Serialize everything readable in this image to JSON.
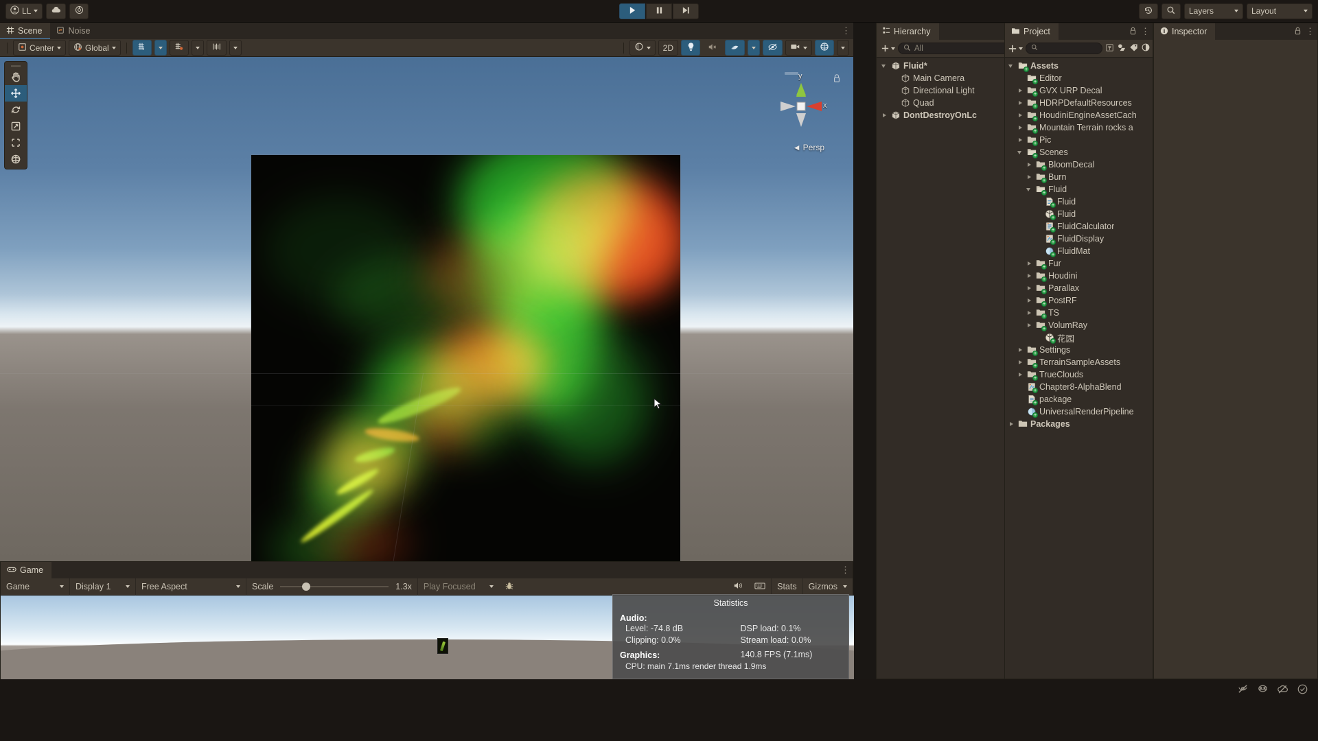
{
  "toolbar": {
    "account_label": "LL",
    "account_icon": "person-icon",
    "cloud_icon": "cloud-icon",
    "services_icon": "services-icon",
    "play_icon": "play-icon",
    "pause_icon": "pause-icon",
    "step_icon": "step-icon",
    "undo_history_icon": "undo-history-icon",
    "search_icon": "search-icon",
    "layers_label": "Layers",
    "layout_label": "Layout"
  },
  "scene": {
    "tabs": [
      {
        "label": "Scene",
        "icon": "scene-grid-icon",
        "selected": true
      },
      {
        "label": "Noise",
        "icon": "noise-icon",
        "selected": false
      }
    ],
    "toolbar": {
      "pivot_label": "Center",
      "pivot_icon": "pivot-center-icon",
      "handle_label": "Global",
      "handle_icon": "globe-icon",
      "grid_icon": "grid-snap-icon",
      "grid_caret": "chevron-down-icon",
      "snap_icon": "snap-increment-icon",
      "snap_caret": "chevron-down-icon",
      "component_icon": "component-tools-icon",
      "component_caret": "chevron-down-icon",
      "shading_icon": "shading-mode-icon",
      "shading_caret": "chevron-down-icon",
      "twod_label": "2D",
      "light_icon": "lighting-icon",
      "audio_icon": "audio-mute-icon",
      "fx_icon": "effects-icon",
      "fx_caret": "chevron-down-icon",
      "hidden_icon": "hidden-objects-icon",
      "camera_icon": "scene-camera-icon",
      "camera_caret": "chevron-down-icon",
      "gizmos_icon": "gizmos-icon",
      "gizmos_caret": "chevron-down-icon"
    },
    "tools": [
      {
        "name": "hand-tool",
        "icon": "hand-icon",
        "active": false
      },
      {
        "name": "move-tool",
        "icon": "move-icon",
        "active": true
      },
      {
        "name": "rotate-tool",
        "icon": "rotate-icon",
        "active": false
      },
      {
        "name": "scale-tool",
        "icon": "scale-icon",
        "active": false
      },
      {
        "name": "rect-tool",
        "icon": "rect-transform-icon",
        "active": false
      },
      {
        "name": "transform-tool",
        "icon": "transform-icon",
        "active": false
      }
    ],
    "gizmo": {
      "axis_y": "y",
      "axis_x": "x",
      "projection_label": "Persp",
      "lock_icon": "lock-icon"
    },
    "cursor_icon": "mouse-pointer-icon"
  },
  "game": {
    "tab_label": "Game",
    "tab_icon": "game-controller-icon",
    "view_select": "Game",
    "display_select": "Display 1",
    "aspect_select": "Free Aspect",
    "scale_label": "Scale",
    "scale_value": "1.3x",
    "play_mode_select": "Play Focused",
    "debug_icon": "bug-icon",
    "mute_icon": "mute-audio-icon",
    "aspect_icon": "aspect-frame-icon",
    "stats_label": "Stats",
    "gizmos_label": "Gizmos",
    "gizmos_caret": "chevron-down-icon"
  },
  "statistics": {
    "title": "Statistics",
    "audio_header": "Audio:",
    "level": "Level: -74.8 dB",
    "clipping": "Clipping: 0.0%",
    "dsp_load": "DSP load: 0.1%",
    "stream_load": "Stream load: 0.0%",
    "graphics_header": "Graphics:",
    "fps": "140.8 FPS (7.1ms)",
    "cpu": "CPU: main 7.1ms  render thread 1.9ms"
  },
  "hierarchy": {
    "tab_label": "Hierarchy",
    "lock_icon": "lock-icon",
    "menu_icon": "kebab-menu-icon",
    "add_icon": "plus-icon",
    "search_placeholder": "All",
    "search_icon": "search-icon",
    "filter_icon": "filter-icon",
    "items": [
      {
        "label": "Fluid*",
        "depth": 0,
        "arrow": "down",
        "icon": "scene-icon",
        "menu": true
      },
      {
        "label": "Main Camera",
        "depth": 1,
        "arrow": "none",
        "icon": "gameobject-icon",
        "menu": false
      },
      {
        "label": "Directional Light",
        "depth": 1,
        "arrow": "none",
        "icon": "gameobject-icon",
        "menu": false
      },
      {
        "label": "Quad",
        "depth": 1,
        "arrow": "none",
        "icon": "gameobject-icon",
        "menu": false
      },
      {
        "label": "DontDestroyOnLc",
        "depth": 0,
        "arrow": "right",
        "icon": "scene-icon",
        "menu": true
      }
    ]
  },
  "project": {
    "tab_label": "Project",
    "tab_icon": "folder-icon",
    "lock_icon": "lock-icon",
    "menu_icon": "kebab-menu-icon",
    "add_icon": "plus-icon",
    "add_caret": "chevron-down-icon",
    "search_icon": "search-icon",
    "filter_icon": "filter-icon",
    "type_filter_icon": "type-filter-icon",
    "label_filter_icon": "label-filter-icon",
    "save_filter_icon": "save-filter-icon",
    "items": [
      {
        "label": "Assets",
        "depth": 0,
        "arrow": "down",
        "icon": "folder-open",
        "bold": true
      },
      {
        "label": "Editor",
        "depth": 1,
        "arrow": "none",
        "icon": "folder-open"
      },
      {
        "label": "GVX URP Decal",
        "depth": 1,
        "arrow": "right",
        "icon": "folder"
      },
      {
        "label": "HDRPDefaultResources",
        "depth": 1,
        "arrow": "right",
        "icon": "folder"
      },
      {
        "label": "HoudiniEngineAssetCach",
        "depth": 1,
        "arrow": "right",
        "icon": "folder"
      },
      {
        "label": "Mountain Terrain rocks a",
        "depth": 1,
        "arrow": "right",
        "icon": "folder"
      },
      {
        "label": "Pic",
        "depth": 1,
        "arrow": "right",
        "icon": "folder"
      },
      {
        "label": "Scenes",
        "depth": 1,
        "arrow": "down",
        "icon": "folder-open"
      },
      {
        "label": "BloomDecal",
        "depth": 2,
        "arrow": "right",
        "icon": "folder"
      },
      {
        "label": "Burn",
        "depth": 2,
        "arrow": "right",
        "icon": "folder"
      },
      {
        "label": "Fluid",
        "depth": 2,
        "arrow": "down",
        "icon": "folder-open"
      },
      {
        "label": "Fluid",
        "depth": 3,
        "arrow": "none",
        "icon": "script"
      },
      {
        "label": "Fluid",
        "depth": 3,
        "arrow": "none",
        "icon": "unity-scene"
      },
      {
        "label": "FluidCalculator",
        "depth": 3,
        "arrow": "none",
        "icon": "compute"
      },
      {
        "label": "FluidDisplay",
        "depth": 3,
        "arrow": "none",
        "icon": "shader"
      },
      {
        "label": "FluidMat",
        "depth": 3,
        "arrow": "none",
        "icon": "material"
      },
      {
        "label": "Fur",
        "depth": 2,
        "arrow": "right",
        "icon": "folder"
      },
      {
        "label": "Houdini",
        "depth": 2,
        "arrow": "right",
        "icon": "folder"
      },
      {
        "label": "Parallax",
        "depth": 2,
        "arrow": "right",
        "icon": "folder"
      },
      {
        "label": "PostRF",
        "depth": 2,
        "arrow": "right",
        "icon": "folder"
      },
      {
        "label": "TS",
        "depth": 2,
        "arrow": "right",
        "icon": "folder"
      },
      {
        "label": "VolumRay",
        "depth": 2,
        "arrow": "right",
        "icon": "folder"
      },
      {
        "label": "花园",
        "depth": 3,
        "arrow": "none",
        "icon": "unity-scene"
      },
      {
        "label": "Settings",
        "depth": 1,
        "arrow": "right",
        "icon": "folder"
      },
      {
        "label": "TerrainSampleAssets",
        "depth": 1,
        "arrow": "right",
        "icon": "folder"
      },
      {
        "label": "TrueClouds",
        "depth": 1,
        "arrow": "right",
        "icon": "folder"
      },
      {
        "label": "Chapter8-AlphaBlend",
        "depth": 1,
        "arrow": "none",
        "icon": "shader"
      },
      {
        "label": "package",
        "depth": 1,
        "arrow": "none",
        "icon": "script"
      },
      {
        "label": "UniversalRenderPipeline",
        "depth": 1,
        "arrow": "none",
        "icon": "material"
      },
      {
        "label": "Packages",
        "depth": 0,
        "arrow": "right",
        "icon": "folder-plain",
        "bold": true
      }
    ]
  },
  "inspector": {
    "tab_label": "Inspector",
    "tab_icon": "info-icon",
    "lock_icon": "lock-icon",
    "menu_icon": "kebab-menu-icon"
  },
  "statusbar": {
    "icons": [
      "no-preview-icon",
      "collab-icon",
      "cloud-build-icon",
      "status-ok-icon"
    ]
  },
  "chart_data": null
}
